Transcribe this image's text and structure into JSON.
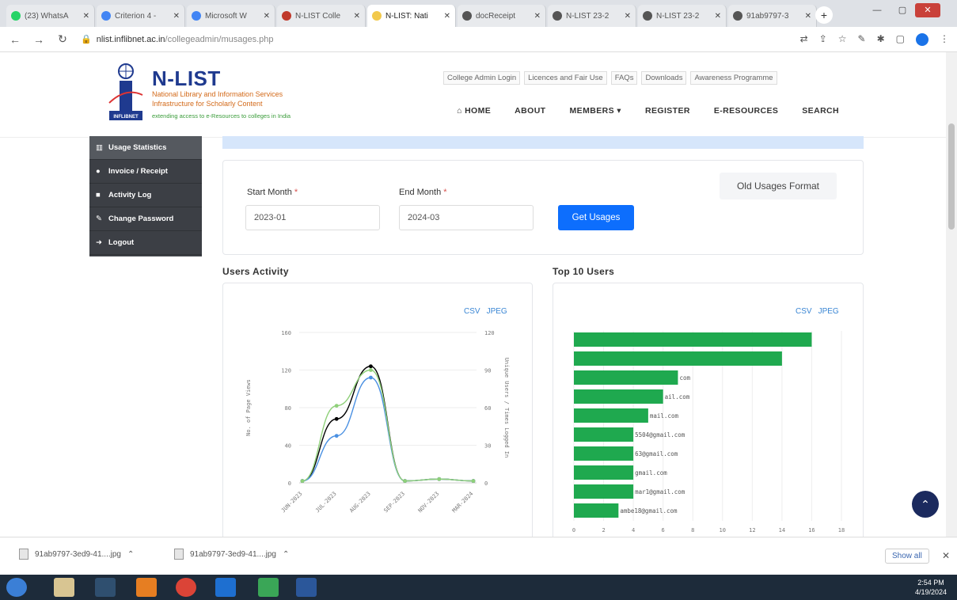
{
  "browser": {
    "tabs": [
      {
        "title": "(23) WhatsA",
        "color": "#25d366"
      },
      {
        "title": "Criterion 4 -",
        "color": "#4285f4"
      },
      {
        "title": "Microsoft W",
        "color": "#4285f4"
      },
      {
        "title": "N-LIST Colle",
        "color": "#c0392b"
      },
      {
        "title": "N-LIST: Nati",
        "color": "#f2c94c"
      },
      {
        "title": "docReceipt",
        "color": "#555555"
      },
      {
        "title": "N-LIST 23-2",
        "color": "#555555"
      },
      {
        "title": "N-LIST 23-2",
        "color": "#555555"
      },
      {
        "title": "91ab9797-3",
        "color": "#555555"
      }
    ],
    "new_tab": "+",
    "url_host": "nlist.inflibnet.ac.in",
    "url_path": "/collegeadmin/musages.php"
  },
  "header": {
    "brand": "N-LIST",
    "sub1": "National Library and Information Services",
    "sub2": "Infrastructure for Scholarly Content",
    "tagline": "extending access to e-Resources to colleges in India",
    "logo_text": "INFLIBNET",
    "top_links": [
      "College Admin Login",
      "Licences and Fair Use",
      "FAQs",
      "Downloads",
      "Awareness Programme"
    ],
    "nav": [
      "HOME",
      "ABOUT",
      "MEMBERS ▾",
      "REGISTER",
      "E-RESOURCES",
      "SEARCH"
    ]
  },
  "sidebar": {
    "items": [
      {
        "label": "Usage Statistics",
        "icon": "▥"
      },
      {
        "label": "Invoice / Receipt",
        "icon": "●"
      },
      {
        "label": "Activity Log",
        "icon": "■"
      },
      {
        "label": "Change Password",
        "icon": "✎"
      },
      {
        "label": "Logout",
        "icon": "➜"
      }
    ]
  },
  "filter": {
    "start_label": "Start Month",
    "start_value": "2023-01",
    "end_label": "End Month",
    "end_value": "2024-03",
    "req": "*",
    "get_button": "Get Usages",
    "old_button": "Old Usages Format"
  },
  "users_activity": {
    "title": "Users Activity",
    "csv": "CSV",
    "jpeg": "JPEG"
  },
  "top_users": {
    "title": "Top 10 Users",
    "csv": "CSV",
    "jpeg": "JPEG"
  },
  "chart_data": [
    {
      "type": "line",
      "title": "",
      "categories": [
        "JUN-2023",
        "JUL-2023",
        "AUG-2023",
        "SEP-2023",
        "NOV-2023",
        "MAR-2024"
      ],
      "ylabel": "No. of Page Views",
      "y2label": "Unique Users / Times Logged In",
      "ylim": [
        0,
        160
      ],
      "y2lim": [
        0,
        120
      ],
      "yticks": [
        0,
        40,
        80,
        120,
        160
      ],
      "y2ticks": [
        0,
        30,
        60,
        90,
        120
      ],
      "grid": true,
      "series": [
        {
          "values": [
            2,
            68,
            124,
            2,
            4,
            2
          ],
          "color": "#000000"
        },
        {
          "values": [
            2,
            50,
            112,
            2,
            4,
            2
          ],
          "color": "#4a90e2"
        },
        {
          "values": [
            2,
            82,
            120,
            2,
            4,
            2
          ],
          "color": "#8fd07a"
        }
      ]
    },
    {
      "type": "bar",
      "orientation": "horizontal",
      "title": "",
      "categories": [
        "",
        "",
        "com",
        "ail.com",
        "mail.com",
        "5504@gmail.com",
        "63@gmail.com",
        "gmail.com",
        "mar1@gmail.com",
        "ambe18@gmail.com"
      ],
      "values": [
        16,
        14,
        7,
        6,
        5,
        4,
        4,
        4,
        4,
        3
      ],
      "xlim": [
        0,
        18
      ],
      "xticks": [
        0,
        2,
        4,
        6,
        8,
        10,
        12,
        14,
        16,
        18
      ],
      "grid": true,
      "color": "#1fa94f"
    }
  ],
  "downloads": {
    "items": [
      "91ab9797-3ed9-41....jpg",
      "91ab9797-3ed9-41....jpg"
    ],
    "show_all": "Show all",
    "close": "✕"
  },
  "taskbar": {
    "time": "2:54 PM",
    "date": "4/19/2024"
  }
}
